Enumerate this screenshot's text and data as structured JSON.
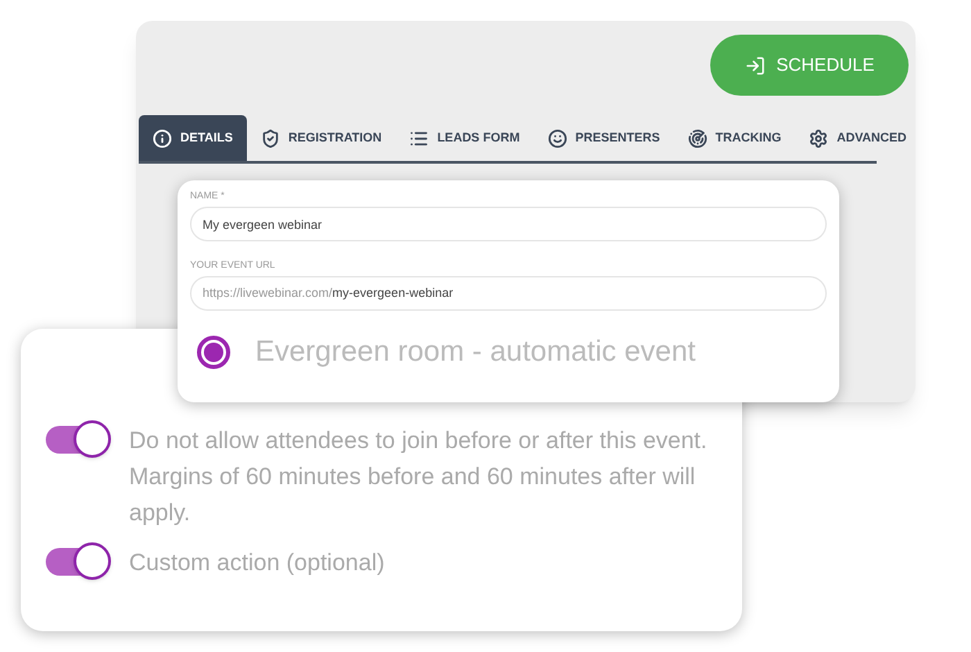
{
  "schedule_button": {
    "label": "SCHEDULE"
  },
  "tabs": [
    {
      "label": "DETAILS",
      "kind": "info",
      "selected": true
    },
    {
      "label": "REGISTRATION",
      "kind": "shield",
      "selected": false
    },
    {
      "label": "LEADS FORM",
      "kind": "list",
      "selected": false
    },
    {
      "label": "PRESENTERS",
      "kind": "face",
      "selected": false
    },
    {
      "label": "TRACKING",
      "kind": "target",
      "selected": false
    },
    {
      "label": "ADVANCED",
      "kind": "gear",
      "selected": false
    }
  ],
  "name_field": {
    "label": "NAME *",
    "value": "My evergeen webinar"
  },
  "url_field": {
    "label": "YOUR EVENT URL",
    "prefix": "https://livewebinar.com/",
    "value": "my-evergeen-webinar"
  },
  "room_option": {
    "label": "Evergreen room - automatic event",
    "selected": true
  },
  "toggles": [
    {
      "label": "Do not allow attendees to join before or after this event. Margins of 60 minutes before and 60 minutes after will apply.",
      "on": true
    },
    {
      "label": "Custom action (optional)",
      "on": true
    }
  ]
}
